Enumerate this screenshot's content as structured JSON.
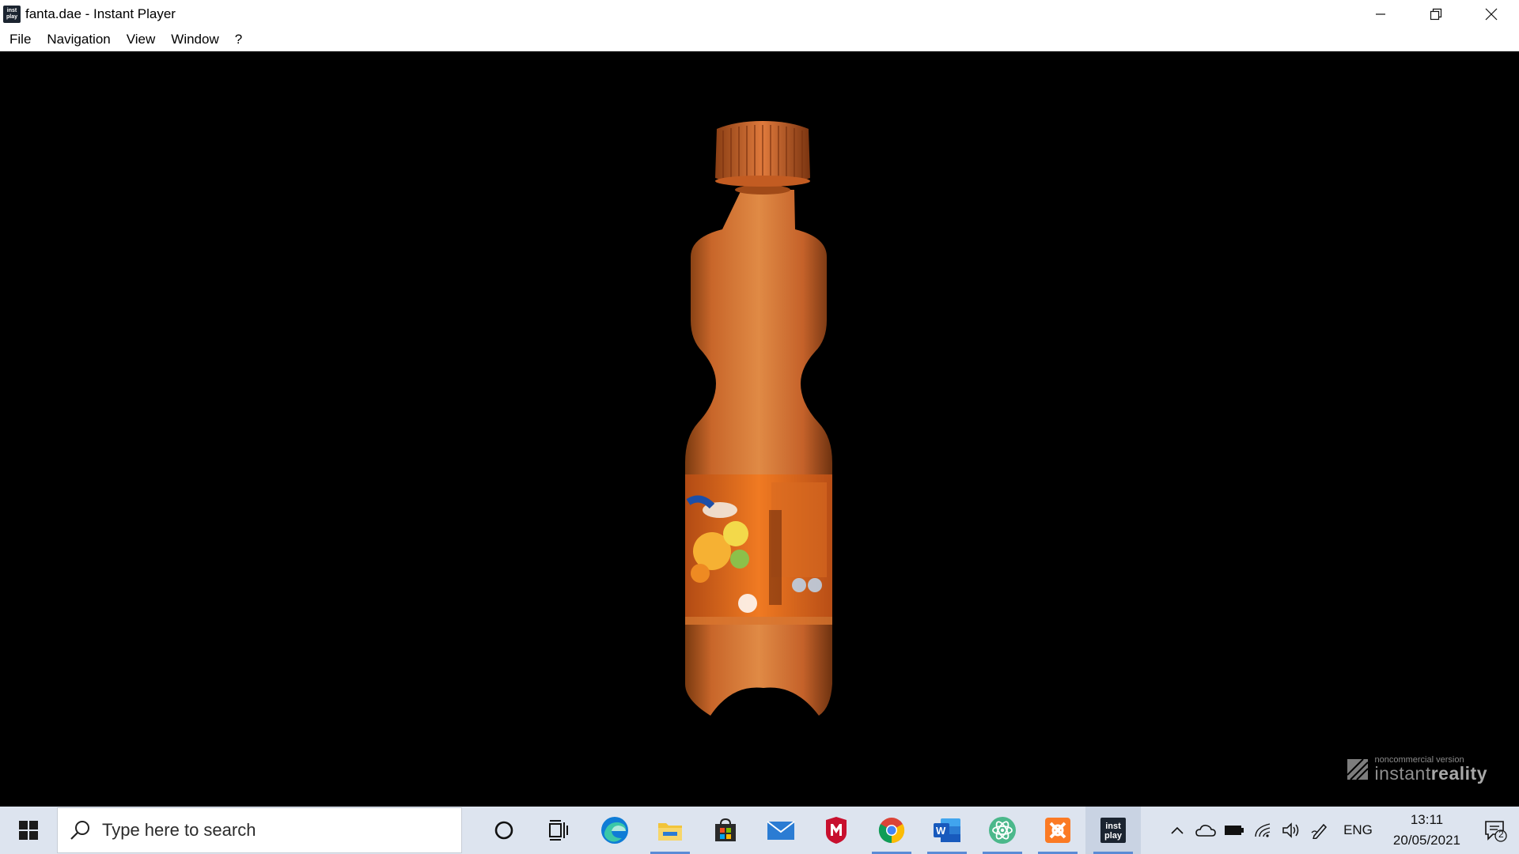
{
  "window": {
    "title": "fanta.dae - Instant Player",
    "app_icon_text": [
      "inst",
      "play"
    ],
    "icon": "instant-player-icon"
  },
  "menu": {
    "items": [
      "File",
      "Navigation",
      "View",
      "Window",
      "?"
    ]
  },
  "viewport": {
    "watermark_small": "noncommercial version",
    "watermark_brand_a": "instant",
    "watermark_brand_b": "reality"
  },
  "taskbar": {
    "search_placeholder": "Type here to search",
    "pinned": [
      {
        "name": "cortana-icon",
        "running": false
      },
      {
        "name": "task-view-icon",
        "running": false
      },
      {
        "name": "edge-icon",
        "running": false
      },
      {
        "name": "file-explorer-icon",
        "running": true
      },
      {
        "name": "store-icon",
        "running": false
      },
      {
        "name": "mail-icon",
        "running": false
      },
      {
        "name": "mcafee-icon",
        "running": false
      },
      {
        "name": "chrome-icon",
        "running": true
      },
      {
        "name": "word-icon",
        "running": true
      },
      {
        "name": "atom-icon",
        "running": true
      },
      {
        "name": "xampp-icon",
        "running": true
      },
      {
        "name": "instant-player-icon",
        "running": true,
        "active": true
      }
    ],
    "tray": {
      "language": "ENG",
      "time": "13:11",
      "date": "20/05/2021",
      "notification_count": "2"
    }
  },
  "colors": {
    "bottle_orange": "#d9762e",
    "taskbar_bg": "#dde4ef",
    "accent": "#5a8bd6"
  }
}
